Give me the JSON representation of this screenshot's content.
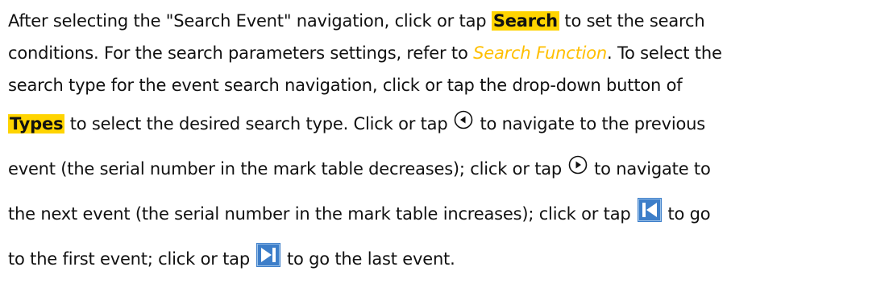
{
  "paragraph": {
    "line1": {
      "before": "After selecting the \"Search Event\" navigation, click or tap ",
      "highlight": "Search",
      "after": " to set the search"
    },
    "line2": {
      "before": "conditions. For the search parameters settings, refer to ",
      "link": "Search Function",
      "after": ". To select the"
    },
    "line3": {
      "text": "search type for the event search navigation, click or tap the drop-down button of"
    },
    "line4": {
      "highlight": "Types",
      "before_icon": " to select the desired search type. Click or tap",
      "after_icon": "to navigate to the previous"
    },
    "line5": {
      "before_icon": "event (the serial number in the mark table decreases); click or tap",
      "after_icon": "to navigate to"
    },
    "line6": {
      "before_icon": "the next event (the serial number in the mark table increases); click or tap",
      "after_icon": "to go"
    },
    "line7": {
      "before_icon": "to the first event; click or tap",
      "after_icon": "to go the last event."
    }
  },
  "icons": {
    "previous": "previous-circle-icon",
    "next": "next-circle-icon",
    "first": "first-event-icon",
    "last": "last-event-icon"
  },
  "colors": {
    "highlight": "#ffd400",
    "link": "#ffbf00",
    "icon_blue": "#3d7ec9"
  }
}
